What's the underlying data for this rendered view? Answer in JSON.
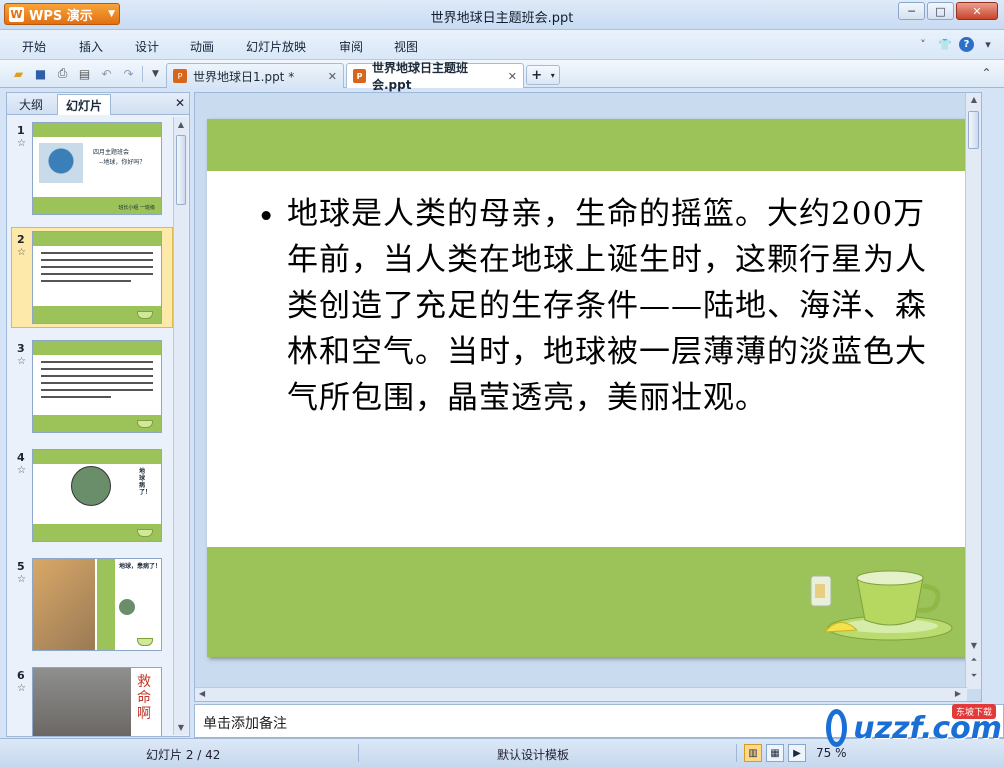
{
  "app": {
    "brand_label": "WPS 演示",
    "brand_letter": "W",
    "window_title": "世界地球日主题班会.ppt"
  },
  "window_controls": {
    "minimize": "─",
    "maximize": "□",
    "close": "✕"
  },
  "menu": {
    "items": [
      "开始",
      "插入",
      "设计",
      "动画",
      "幻灯片放映",
      "审阅",
      "视图"
    ]
  },
  "doc_tabs": [
    {
      "label": "世界地球日1.ppt *",
      "active": false
    },
    {
      "label": "世界地球日主题班会.ppt",
      "active": true
    }
  ],
  "left_panel": {
    "tabs": [
      "大纲",
      "幻灯片"
    ],
    "active_tab": "幻灯片",
    "close_glyph": "✕",
    "thumbnails": [
      {
        "number": "1",
        "title_line": "四月主题班会",
        "sub_line": "--地球，你好吗？",
        "footer": "班长小组    一班级"
      },
      {
        "number": "2",
        "selected": true
      },
      {
        "number": "3"
      },
      {
        "number": "4",
        "side_text": "地球病了！"
      },
      {
        "number": "5",
        "side_text": "地球，患病了！"
      },
      {
        "number": "6",
        "side_text": "救命啊"
      }
    ]
  },
  "slide": {
    "bullet": "•",
    "body": "地球是人类的母亲，生命的摇篮。大约200万年前，当人类在地球上诞生时，这颗行星为人类创造了充足的生存条件——陆地、海洋、森林和空气。当时，地球被一层薄薄的淡蓝色大气所包围，晶莹透亮，美丽壮观。"
  },
  "notes": {
    "placeholder": "单击添加备注"
  },
  "status": {
    "slide_info": "幻灯片 2 / 42",
    "template": "默认设计模板",
    "zoom": "75 %"
  },
  "watermark": {
    "text": "uzzf.com",
    "badge": "东坡下载"
  },
  "colors": {
    "slide_green": "#9cc359",
    "brand_orange": "#e26f12"
  }
}
